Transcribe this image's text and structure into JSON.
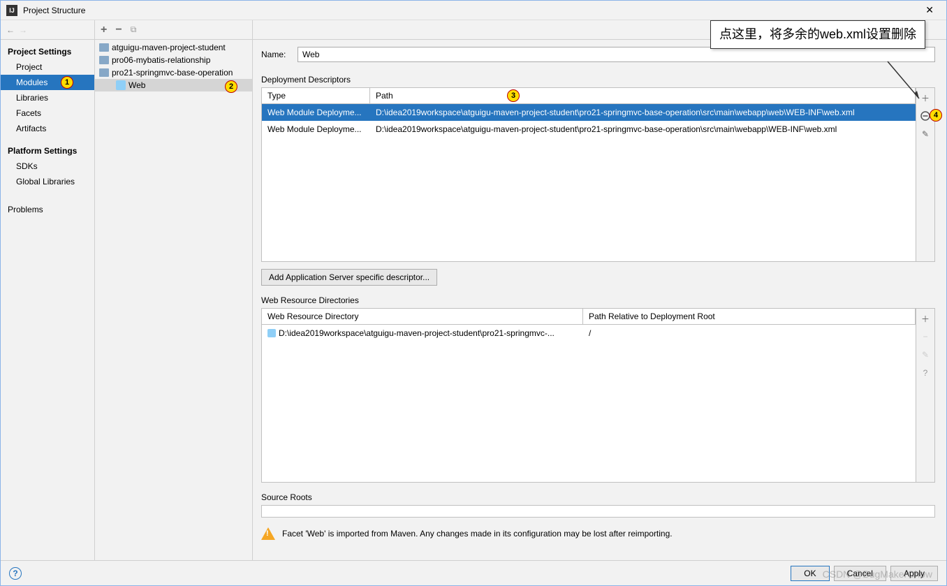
{
  "window": {
    "title": "Project Structure"
  },
  "callout": {
    "text": "点这里，将多余的web.xml设置删除"
  },
  "sidebar": {
    "heading1": "Project Settings",
    "items1": [
      "Project",
      "Modules",
      "Libraries",
      "Facets",
      "Artifacts"
    ],
    "heading2": "Platform Settings",
    "items2": [
      "SDKs",
      "Global Libraries"
    ],
    "problems": "Problems"
  },
  "tree": {
    "root": "atguigu-maven-project-student",
    "children": [
      "pro06-mybatis-relationship",
      "pro21-springmvc-base-operation"
    ],
    "grandchild": "Web"
  },
  "content": {
    "name_label": "Name:",
    "name_value": "Web",
    "deploy_label": "Deployment Descriptors",
    "headers": {
      "type": "Type",
      "path": "Path"
    },
    "rows": [
      {
        "type": "Web Module Deployme...",
        "path": "D:\\idea2019workspace\\atguigu-maven-project-student\\pro21-springmvc-base-operation\\src\\main\\webapp\\web\\WEB-INF\\web.xml"
      },
      {
        "type": "Web Module Deployme...",
        "path": "D:\\idea2019workspace\\atguigu-maven-project-student\\pro21-springmvc-base-operation\\src\\main\\webapp\\WEB-INF\\web.xml"
      }
    ],
    "add_server_btn": "Add Application Server specific descriptor...",
    "res_label": "Web Resource Directories",
    "res_headers": {
      "dir": "Web Resource Directory",
      "rel": "Path Relative to Deployment Root"
    },
    "res_rows": [
      {
        "dir": "D:\\idea2019workspace\\atguigu-maven-project-student\\pro21-springmvc-...",
        "rel": "/"
      }
    ],
    "source_roots": "Source Roots",
    "warning": "Facet 'Web' is imported from Maven. Any changes made in its configuration may be lost after reimporting."
  },
  "footer": {
    "ok": "OK",
    "cancel": "Cancel",
    "apply": "Apply"
  },
  "badges": [
    "1",
    "2",
    "3",
    "4"
  ],
  "watermark": "CSDN @BugMakerChow"
}
